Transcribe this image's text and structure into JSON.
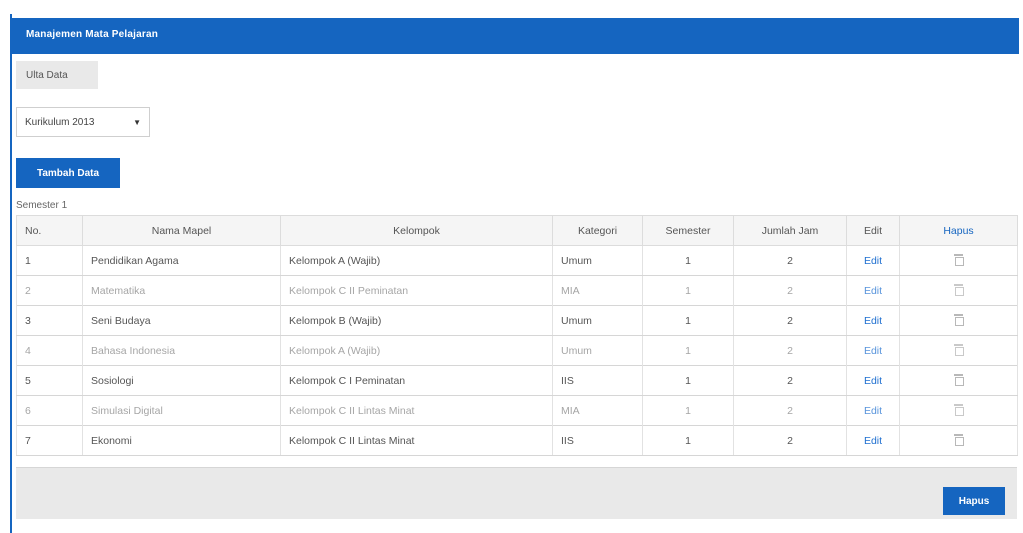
{
  "header": {
    "title": "Manajemen Mata Pelajaran"
  },
  "toolbar": {
    "grey_button_label": "Ulta Data",
    "curriculum_select_value": "Kurikulum 2013",
    "add_button_label": "Tambah Data"
  },
  "semester_label": "Semester 1",
  "table": {
    "headers": {
      "no": "No.",
      "nama": "Nama Mapel",
      "kelompok": "Kelompok",
      "kategori": "Kategori",
      "semester": "Semester",
      "jam": "Jumlah Jam",
      "edit": "Edit",
      "hapus": "Hapus"
    },
    "rows": [
      {
        "no": "1",
        "nama": "Pendidikan Agama",
        "kelompok": "Kelompok A (Wajib)",
        "kategori": "Umum",
        "semester": "1",
        "jam": "2",
        "edit": "Edit"
      },
      {
        "no": "2",
        "nama": "Matematika",
        "kelompok": "Kelompok C II Peminatan",
        "kategori": "MIA",
        "semester": "1",
        "jam": "2",
        "edit": "Edit"
      },
      {
        "no": "3",
        "nama": "Seni Budaya",
        "kelompok": "Kelompok B (Wajib)",
        "kategori": "Umum",
        "semester": "1",
        "jam": "2",
        "edit": "Edit"
      },
      {
        "no": "4",
        "nama": "Bahasa Indonesia",
        "kelompok": "Kelompok A (Wajib)",
        "kategori": "Umum",
        "semester": "1",
        "jam": "2",
        "edit": "Edit"
      },
      {
        "no": "5",
        "nama": "Sosiologi",
        "kelompok": "Kelompok C I Peminatan",
        "kategori": "IIS",
        "semester": "1",
        "jam": "2",
        "edit": "Edit"
      },
      {
        "no": "6",
        "nama": "Simulasi Digital",
        "kelompok": "Kelompok C II Lintas Minat",
        "kategori": "MIA",
        "semester": "1",
        "jam": "2",
        "edit": "Edit"
      },
      {
        "no": "7",
        "nama": "Ekonomi",
        "kelompok": "Kelompok C II Lintas Minat",
        "kategori": "IIS",
        "semester": "1",
        "jam": "2",
        "edit": "Edit"
      }
    ]
  },
  "footer": {
    "delete_button_label": "Hapus"
  },
  "colors": {
    "primary": "#1565c0",
    "link": "#1e6fd0"
  }
}
